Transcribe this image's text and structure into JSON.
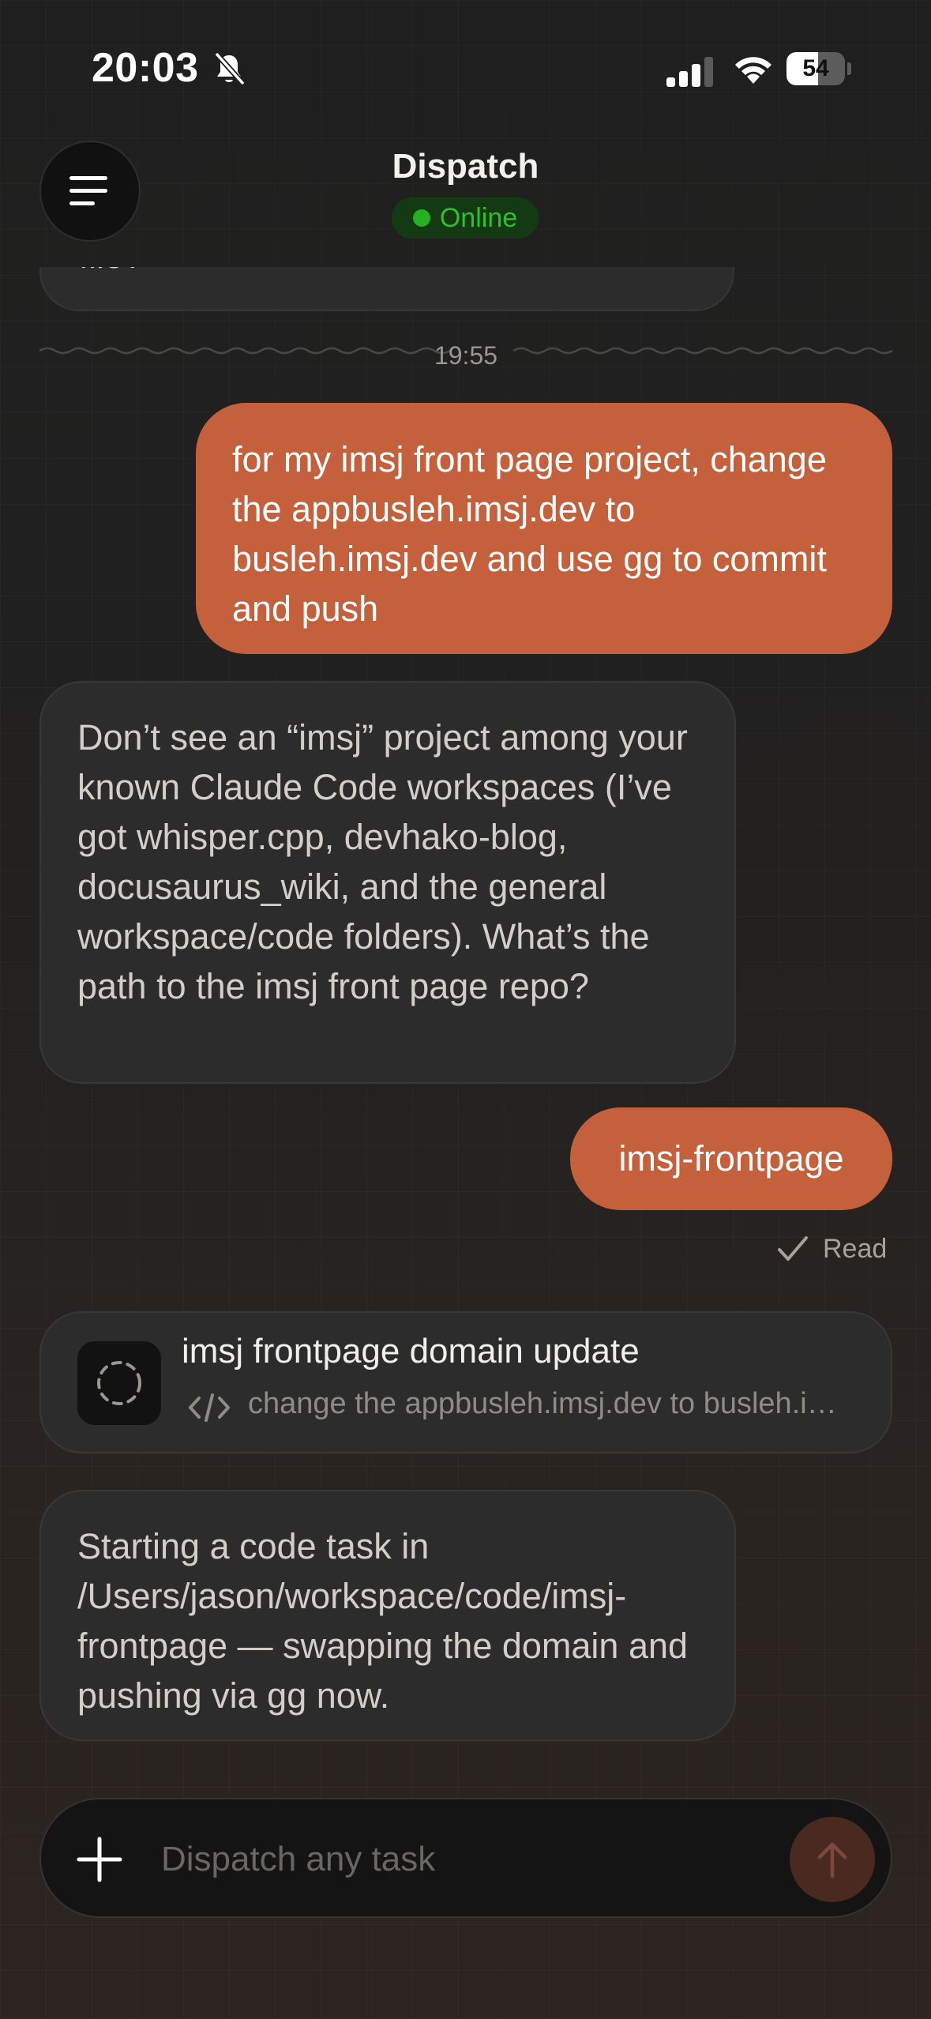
{
  "status_bar": {
    "time": "20:03",
    "battery_level": "54",
    "icons": [
      "bell-slash-icon",
      "cellular-signal-icon",
      "wifi-icon",
      "battery-icon"
    ]
  },
  "header": {
    "title": "Dispatch",
    "status": "Online",
    "menu_icon": "hamburger-menu-icon"
  },
  "chat": {
    "previous_message_fragment": "file?",
    "divider_time": "19:55",
    "messages": [
      {
        "role": "user",
        "text": "for my imsj front page project, change the appbusleh.imsj.dev to busleh.imsj.dev and use gg to commit and push"
      },
      {
        "role": "agent",
        "text": "Don’t see an “imsj” project among your known Claude Code workspaces (I’ve got whisper.cpp, devhako-blog, docusaurus_wiki, and the general workspace/code folders). What’s the path to the imsj front page repo?"
      },
      {
        "role": "user",
        "text": "imsj-frontpage"
      },
      {
        "role": "agent",
        "text": "Starting a code task in /Users/jason/workspace/code/imsj-frontpage — swapping the domain and pushing via gg now."
      }
    ],
    "read_receipt": "Read",
    "task_card": {
      "title": "imsj frontpage domain update",
      "subtitle": "change the appbusleh.imsj.dev to busleh.imsj.dev and use gg to commit and push",
      "icon": "spinner-dashed-icon",
      "sub_icon": "code-icon"
    }
  },
  "composer": {
    "placeholder": "Dispatch any task",
    "value": "",
    "plus_icon": "plus-icon",
    "send_icon": "arrow-up-icon"
  },
  "colors": {
    "user_bubble": "#c4603c",
    "agent_bubble": "#2c2c2c",
    "online_green": "#2fbf2f",
    "background": "#1f1f1f"
  }
}
